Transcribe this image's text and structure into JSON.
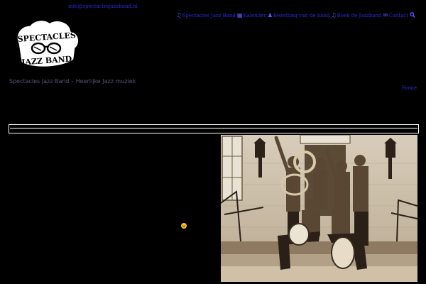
{
  "header": {
    "email": "info@spectaclesjazzband.nl",
    "logo": {
      "line1": "SPECTACLES",
      "line2": "JAZZ BAND"
    },
    "tagline": "Spectacles Jazz Band – Heerlijke Jazz muziek"
  },
  "nav": {
    "items": [
      {
        "label": "Spectacles Jazz Band",
        "icon": "music-note-icon"
      },
      {
        "label": "Kalender",
        "icon": "calendar-icon"
      },
      {
        "label": "Bezetting van de band",
        "icon": "people-icon"
      },
      {
        "label": "Boek de Jazzband",
        "icon": "music-note-icon"
      },
      {
        "label": "Contact",
        "icon": "envelope-icon"
      }
    ],
    "search_icon": "search-icon"
  },
  "breadcrumb": {
    "home": "Home"
  },
  "content": {
    "emoji": "smiley-icon"
  },
  "colors": {
    "background": "#000000",
    "link": "#2b2bd4",
    "icon": "#6b52ff",
    "muted_text": "#55557a"
  }
}
